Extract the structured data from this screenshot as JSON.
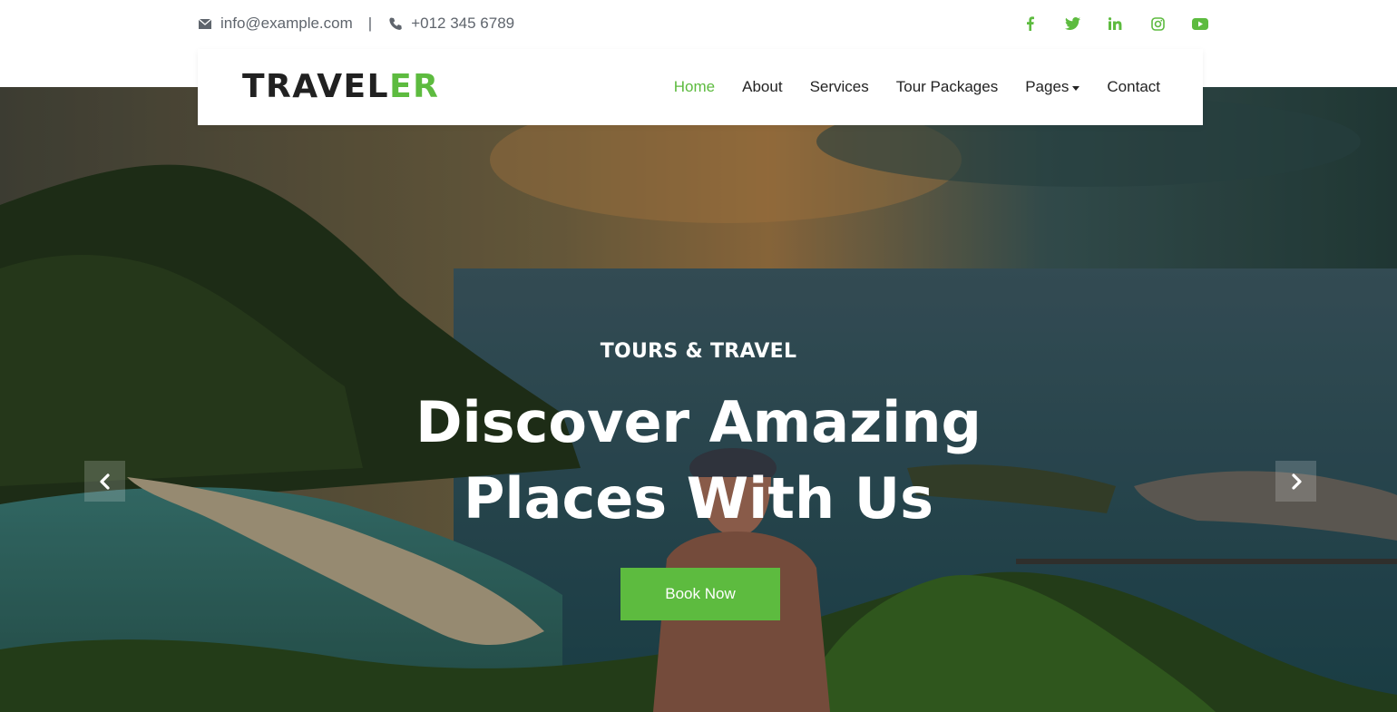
{
  "topbar": {
    "email": "info@example.com",
    "separator": "|",
    "phone": "+012 345 6789",
    "icons": [
      "envelope-icon",
      "phone-icon"
    ],
    "socials": [
      "facebook-icon",
      "twitter-icon",
      "linkedin-icon",
      "instagram-icon",
      "youtube-icon"
    ]
  },
  "navbar": {
    "logo_dark": "TRAVEL",
    "logo_green": "ER",
    "items": [
      {
        "label": "Home",
        "active": true
      },
      {
        "label": "About"
      },
      {
        "label": "Services"
      },
      {
        "label": "Tour Packages"
      },
      {
        "label": "Pages",
        "dropdown": true
      },
      {
        "label": "Contact"
      }
    ]
  },
  "hero": {
    "eyebrow": "TOURS & TRAVEL",
    "headline_line1": "Discover Amazing",
    "headline_line2": "Places With Us",
    "cta_label": "Book Now",
    "prev_icon": "chevron-left-icon",
    "next_icon": "chevron-right-icon"
  },
  "colors": {
    "accent": "#5dbb3f",
    "text_dark": "#212121",
    "text_muted": "#5f656d"
  }
}
